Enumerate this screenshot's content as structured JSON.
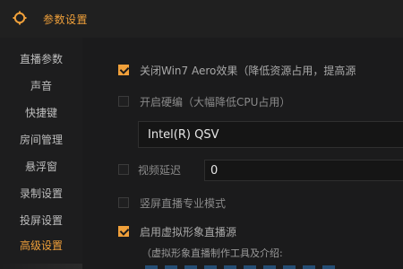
{
  "window": {
    "title": "参数设置",
    "accent": "#f0a03a"
  },
  "sidebar": {
    "items": [
      {
        "label": "直播参数",
        "active": false
      },
      {
        "label": "声音",
        "active": false
      },
      {
        "label": "快捷键",
        "active": false
      },
      {
        "label": "房间管理",
        "active": false
      },
      {
        "label": "悬浮窗",
        "active": false
      },
      {
        "label": "录制设置",
        "active": false
      },
      {
        "label": "投屏设置",
        "active": false
      },
      {
        "label": "高级设置",
        "active": true
      }
    ]
  },
  "settings": {
    "aero": {
      "label": "关闭Win7 Aero效果（降低资源占用，提高源",
      "checked": true
    },
    "hw_encode": {
      "label": "开启硬编（大幅降低CPU占用）",
      "checked": false
    },
    "encoder_select": {
      "value": "Intel(R) QSV"
    },
    "video_delay": {
      "label": "视频延迟",
      "checked": false,
      "value": "0"
    },
    "vertical_mode": {
      "label": "竖屏直播专业模式",
      "checked": false
    },
    "virtual_source": {
      "label": "启用虚拟形象直播源",
      "checked": true
    },
    "virtual_desc": "（虚拟形象直播制作工具及介绍:"
  }
}
